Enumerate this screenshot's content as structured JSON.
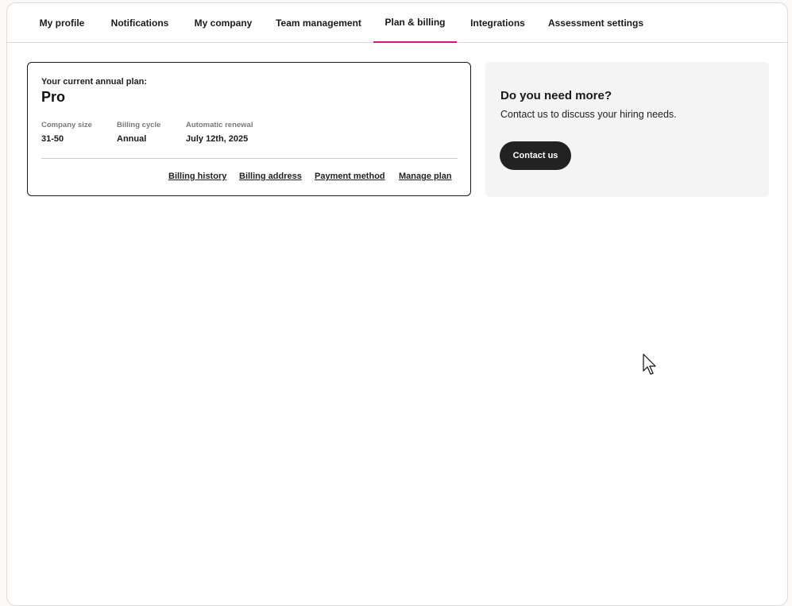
{
  "tabs": [
    {
      "label": "My profile",
      "active": false
    },
    {
      "label": "Notifications",
      "active": false
    },
    {
      "label": "My company",
      "active": false
    },
    {
      "label": "Team management",
      "active": false
    },
    {
      "label": "Plan & billing",
      "active": true
    },
    {
      "label": "Integrations",
      "active": false
    },
    {
      "label": "Assessment settings",
      "active": false
    }
  ],
  "plan": {
    "caption": "Your current annual plan:",
    "name": "Pro",
    "company_size_label": "Company size",
    "company_size_value": "31-50",
    "billing_cycle_label": "Billing cycle",
    "billing_cycle_value": "Annual",
    "renewal_label": "Automatic renewal",
    "renewal_value": "July 12th, 2025",
    "links": {
      "billing_history": "Billing history",
      "billing_address": "Billing address",
      "payment_method": "Payment method",
      "manage_plan": "Manage plan"
    }
  },
  "more": {
    "title": "Do you need more?",
    "text": "Contact us to discuss your hiring needs.",
    "button": "Contact us"
  },
  "colors": {
    "active_tab_underline": "#d1187c",
    "button_bg": "#222222",
    "side_card_bg": "#f4f4f4"
  },
  "icons": {
    "cursor": "mouse-pointer-icon"
  }
}
